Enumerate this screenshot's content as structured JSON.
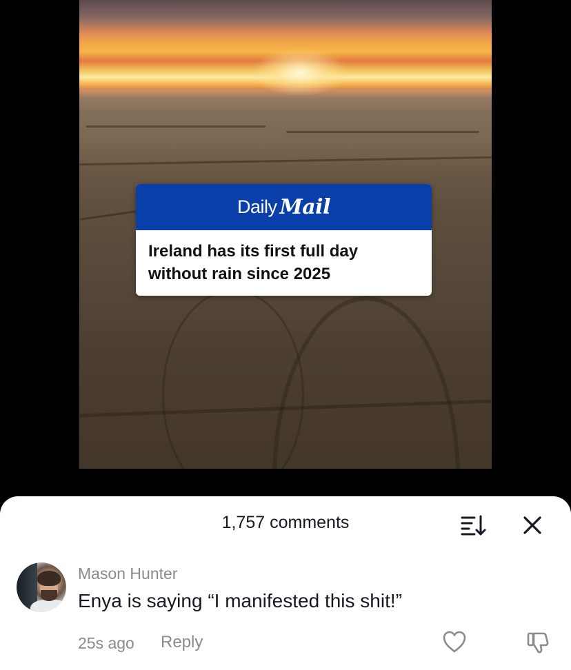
{
  "video": {
    "news_card": {
      "brand_daily": "Daily",
      "brand_mail": "Mail",
      "headline_line1": "Ireland has its first full day",
      "headline_line2": "without rain since 2025",
      "brand_color": "#0a3fa9"
    }
  },
  "comments_sheet": {
    "title": "1,757 comments",
    "sort_icon": "sort-descending-icon",
    "close_icon": "close-icon",
    "comments": [
      {
        "username": "Mason Hunter",
        "text": "Enya is saying “I manifested this shit!”",
        "timestamp": "25s ago",
        "reply_label": "Reply",
        "like_icon": "heart-outline-icon",
        "dislike_icon": "thumbs-down-icon"
      }
    ]
  },
  "colors": {
    "text_primary": "#161823",
    "text_secondary": "#8a8b91",
    "background": "#000000",
    "sheet": "#ffffff"
  }
}
